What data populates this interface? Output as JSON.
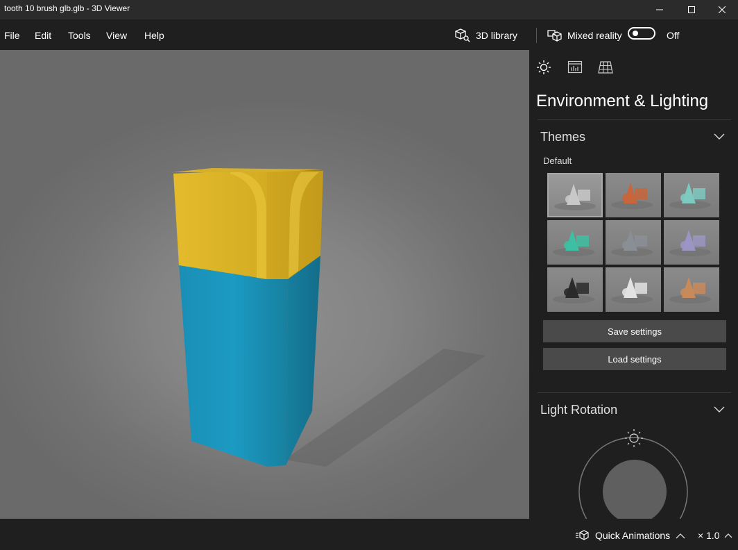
{
  "window": {
    "title": "tooth 10 brush glb.glb - 3D Viewer"
  },
  "menu": {
    "file": "File",
    "edit": "Edit",
    "tools": "Tools",
    "view": "View",
    "help": "Help"
  },
  "toolbar": {
    "library": "3D library",
    "mixed_reality": "Mixed reality",
    "toggle_state": "Off"
  },
  "panel": {
    "title": "Environment & Lighting",
    "themes": {
      "heading": "Themes",
      "default_label": "Default",
      "thumbnails": [
        {
          "accent": "#c8c8c8"
        },
        {
          "accent": "#c8653a"
        },
        {
          "accent": "#7ec9c0"
        },
        {
          "accent": "#3cbfa2"
        },
        {
          "accent": "#8a8f96"
        },
        {
          "accent": "#9a95c2"
        },
        {
          "accent": "#2a2a2a"
        },
        {
          "accent": "#e2e2e2"
        },
        {
          "accent": "#c98a5a"
        }
      ],
      "save_label": "Save settings",
      "load_label": "Load settings"
    },
    "light_rotation": {
      "heading": "Light Rotation"
    }
  },
  "status": {
    "quick_animations": "Quick Animations",
    "speed": "× 1.0"
  },
  "colors": {
    "accent_yellow": "#e1b92b",
    "accent_blue": "#1593b8"
  }
}
